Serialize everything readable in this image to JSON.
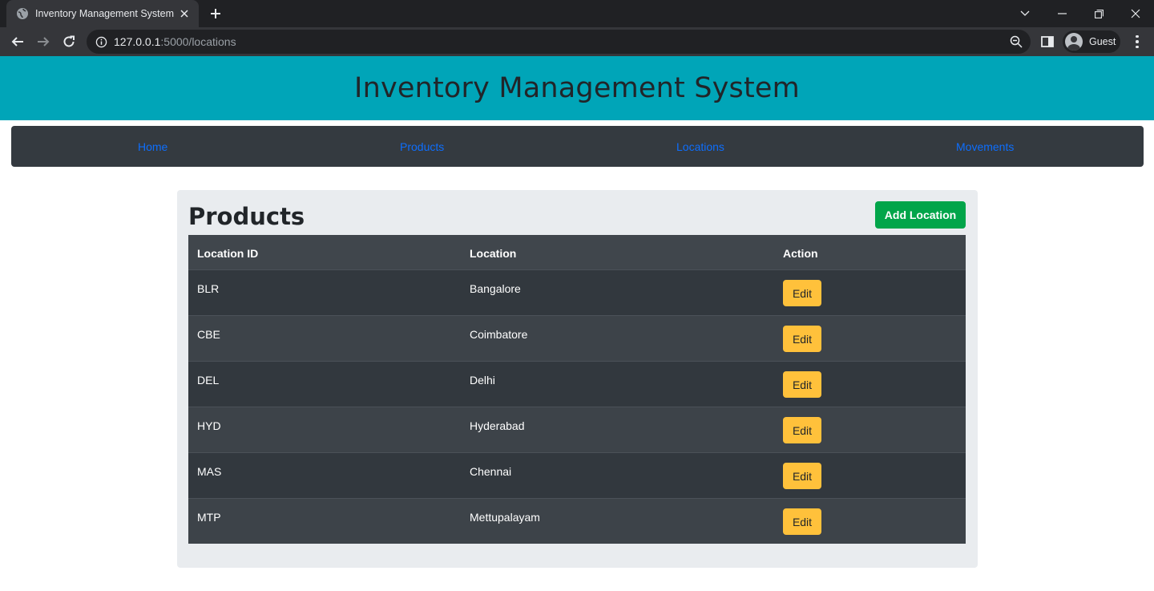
{
  "browser": {
    "tab_title": "Inventory Management System",
    "url_host": "127.0.0.1",
    "url_rest": ":5000/locations",
    "profile_label": "Guest"
  },
  "header": {
    "title": "Inventory Management System"
  },
  "nav": {
    "items": [
      {
        "label": "Home"
      },
      {
        "label": "Products"
      },
      {
        "label": "Locations"
      },
      {
        "label": "Movements"
      }
    ]
  },
  "main": {
    "title": "Products",
    "add_button": "Add Location",
    "table": {
      "headers": [
        "Location ID",
        "Location",
        "Action"
      ],
      "rows": [
        {
          "id": "BLR",
          "location": "Bangalore",
          "action": "Edit"
        },
        {
          "id": "CBE",
          "location": "Coimbatore",
          "action": "Edit"
        },
        {
          "id": "DEL",
          "location": "Delhi",
          "action": "Edit"
        },
        {
          "id": "HYD",
          "location": "Hyderabad",
          "action": "Edit"
        },
        {
          "id": "MAS",
          "location": "Chennai",
          "action": "Edit"
        },
        {
          "id": "MTP",
          "location": "Mettupalayam",
          "action": "Edit"
        }
      ]
    }
  },
  "colors": {
    "banner": "#00a5b8",
    "navbar": "#343a40",
    "nav_link": "#0d6efd",
    "add_button": "#02a54a",
    "edit_button": "#ffc13b"
  }
}
